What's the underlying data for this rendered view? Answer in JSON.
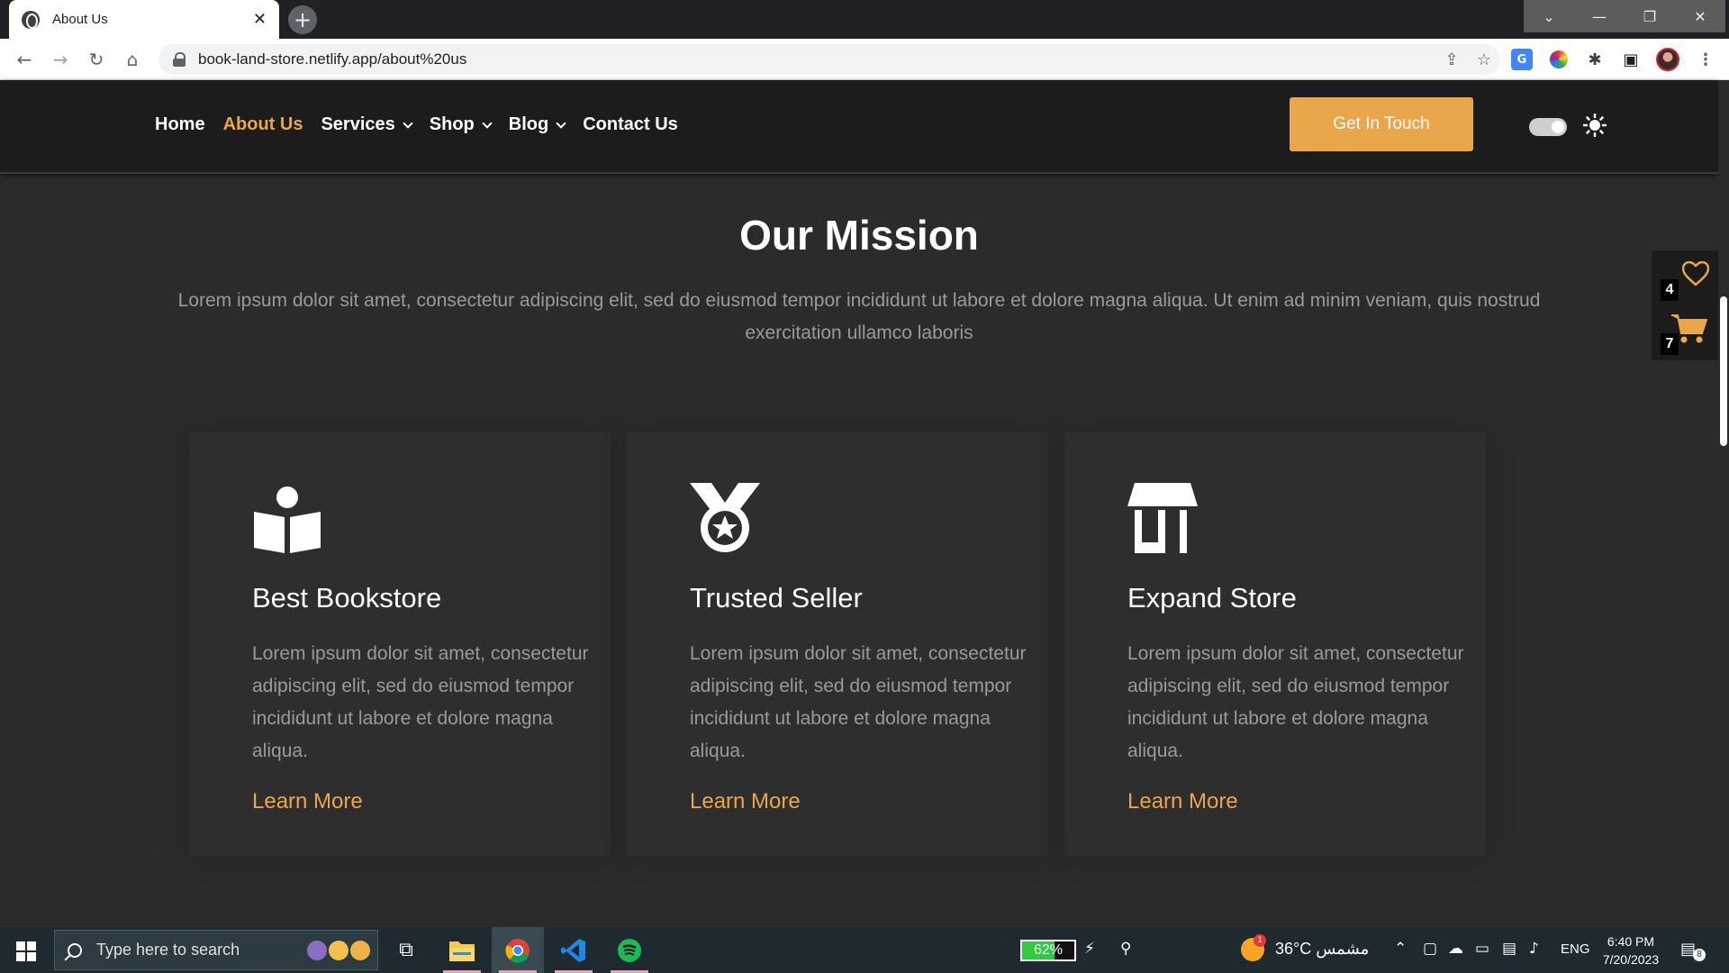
{
  "browser": {
    "tab_title": "About Us",
    "tab_close": "✕",
    "new_tab": "+",
    "url": "book-land-store.netlify.app/about%20us",
    "window_controls": {
      "dropdown": "⌄",
      "minimize": "—",
      "maximize": "❐",
      "close": "✕"
    },
    "nav": {
      "back": "←",
      "forward": "→",
      "reload": "↻",
      "home": "⌂"
    },
    "omni_icons": {
      "share": "⇪",
      "star": "☆"
    },
    "extensions": {
      "translate": "G",
      "puzzle": "✱",
      "panel": "▣",
      "menu": "⋮"
    }
  },
  "site": {
    "nav_items": [
      {
        "label": "Home",
        "active": false
      },
      {
        "label": "About Us",
        "active": true
      },
      {
        "label": "Services",
        "active": false,
        "dropdown": true
      },
      {
        "label": "Shop",
        "active": false,
        "dropdown": true
      },
      {
        "label": "Blog",
        "active": false,
        "dropdown": true
      },
      {
        "label": "Contact Us",
        "active": false
      }
    ],
    "cta_label": "Get In Touch",
    "theme_toggle_on": true,
    "wishlist_count": "4",
    "cart_count": "7",
    "accent_color": "#e9a64b"
  },
  "mission": {
    "title": "Our Mission",
    "text": "Lorem ipsum dolor sit amet, consectetur adipiscing elit, sed do eiusmod tempor incididunt ut labore et dolore magna aliqua. Ut enim ad minim veniam, quis nostrud exercitation ullamco laboris"
  },
  "cards": [
    {
      "icon": "book-reader-icon",
      "title": "Best Bookstore",
      "text": "Lorem ipsum dolor sit amet, consectetur adipiscing elit, sed do eiusmod tempor incididunt ut labore et dolore magna aliqua.",
      "link": "Learn More"
    },
    {
      "icon": "medal-icon",
      "title": "Trusted Seller",
      "text": "Lorem ipsum dolor sit amet, consectetur adipiscing elit, sed do eiusmod tempor incididunt ut labore et dolore magna aliqua.",
      "link": "Learn More"
    },
    {
      "icon": "store-icon",
      "title": "Expand Store",
      "text": "Lorem ipsum dolor sit amet, consectetur adipiscing elit, sed do eiusmod tempor incididunt ut labore et dolore magna aliqua.",
      "link": "Learn More"
    }
  ],
  "taskbar": {
    "search_placeholder": "Type here to search",
    "battery_percent": "62%",
    "battery_level": 0.62,
    "weather": "36°C مشمس",
    "weather_badge": "1",
    "language": "ENG",
    "time": "6:40 PM",
    "date": "7/20/2023",
    "notification_count": "8"
  }
}
